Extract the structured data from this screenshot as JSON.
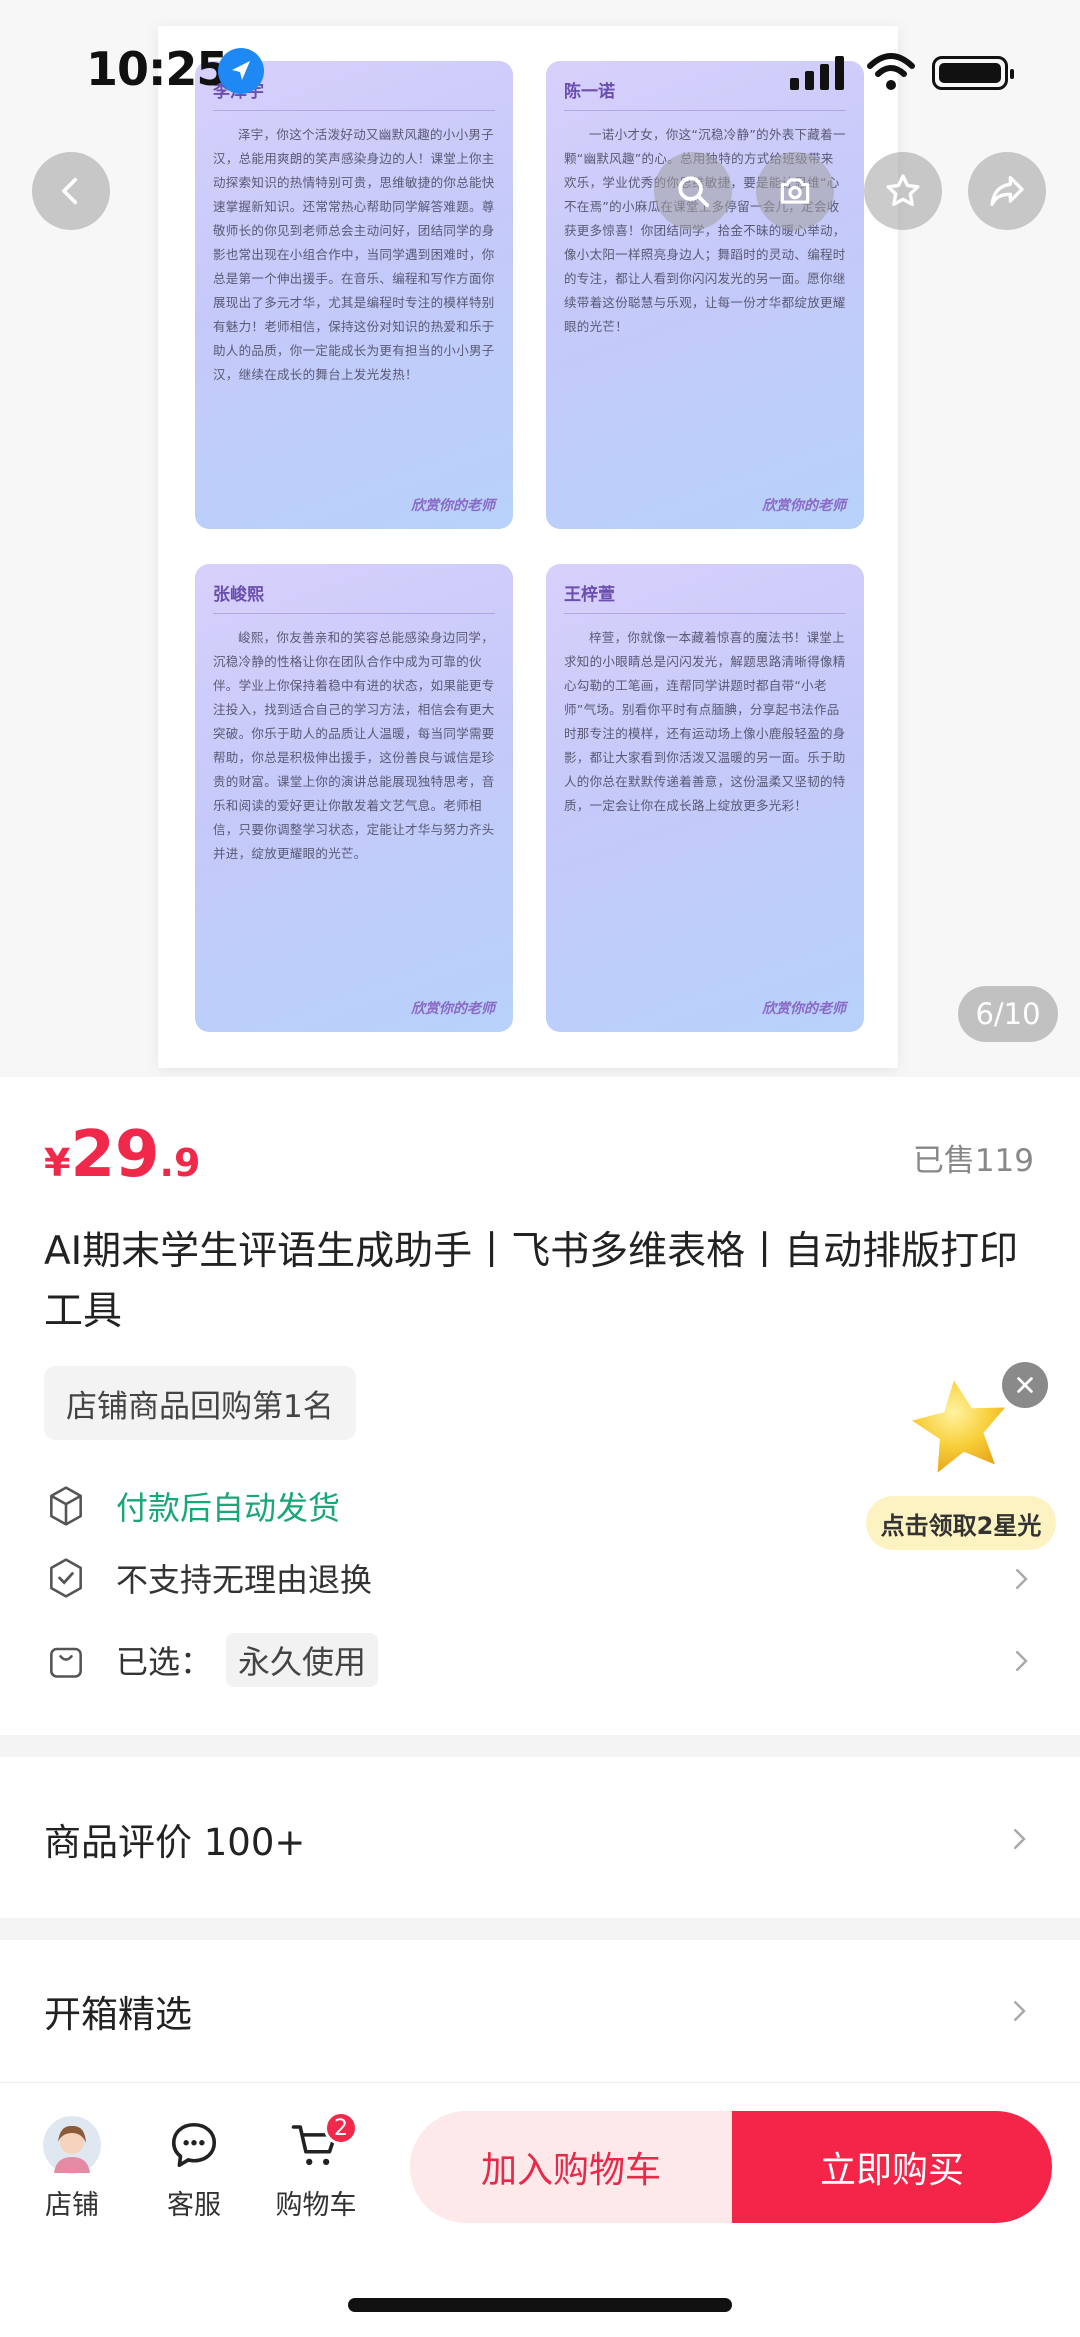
{
  "status_bar": {
    "time": "10:25"
  },
  "gallery": {
    "counter": "6/10",
    "cards": [
      {
        "name": "李泽宇",
        "body": "泽宇，你这个活泼好动又幽默风趣的小小男子汉，总能用爽朗的笑声感染身边的人！课堂上你主动探索知识的热情特别可贵，思维敏捷的你总能快速掌握新知识。还常常热心帮助同学解答难题。尊敬师长的你见到老师总会主动问好，团结同学的身影也常出现在小组合作中，当同学遇到困难时，你总是第一个伸出援手。在音乐、编程和写作方面你展现出了多元才华，尤其是编程时专注的模样特别有魅力！老师相信，保持这份对知识的热爱和乐于助人的品质，你一定能成长为更有担当的小小男子汉，继续在成长的舞台上发光发热！",
        "sign": "欣赏你的老师"
      },
      {
        "name": "陈一诺",
        "body": "一诺小才女，你这“沉稳冷静”的外表下藏着一颗“幽默风趣”的心。总用独特的方式给班级带来欢乐，学业优秀的你思维敏捷，要是能让思维“心不在焉”的小麻瓜在课堂上多停留一会儿，定会收获更多惊喜！你团结同学，拾金不昧的暖心举动，像小太阳一样照亮身边人；舞蹈时的灵动、编程时的专注，都让人看到你闪闪发光的另一面。愿你继续带着这份聪慧与乐观，让每一份才华都绽放更耀眼的光芒！",
        "sign": "欣赏你的老师"
      },
      {
        "name": "张峻熙",
        "body": "峻熙，你友善亲和的笑容总能感染身边同学，沉稳冷静的性格让你在团队合作中成为可靠的伙伴。学业上你保持着稳中有进的状态，如果能更专注投入，找到适合自己的学习方法，相信会有更大突破。你乐于助人的品质让人温暖，每当同学需要帮助，你总是积极伸出援手，这份善良与诚信是珍贵的财富。课堂上你的演讲总能展现独特思考，音乐和阅读的爱好更让你散发着文艺气息。老师相信，只要你调整学习状态，定能让才华与努力齐头并进，绽放更耀眼的光芒。",
        "sign": "欣赏你的老师"
      },
      {
        "name": "王梓萱",
        "body": "梓萱，你就像一本藏着惊喜的魔法书！课堂上求知的小眼睛总是闪闪发光，解题思路清晰得像精心勾勒的工笔画，连帮同学讲题时都自带“小老师”气场。别看你平时有点腼腆，分享起书法作品时那专注的模样，还有运动场上像小鹿般轻盈的身影，都让大家看到你活泼又温暖的另一面。乐于助人的你总在默默传递着善意，这份温柔又坚韧的特质，一定会让你在成长路上绽放更多光彩！",
        "sign": "欣赏你的老师"
      }
    ]
  },
  "product": {
    "price_symbol": "¥",
    "price_int": "29",
    "price_dec": ".9",
    "sold": "已售119",
    "title": "AI期末学生评语生成助手丨飞书多维表格丨自动排版打印工具",
    "rank_tag": "店铺商品回购第1名",
    "delivery": "付款后自动发货",
    "return_policy": "不支持无理由退换",
    "selected_label": "已选：",
    "selected_value": "永久使用",
    "promo": "点击领取2星光"
  },
  "sections": {
    "reviews": "商品评价 100+",
    "unboxing": "开箱精选"
  },
  "bottom_bar": {
    "shop": "店铺",
    "service": "客服",
    "cart": "购物车",
    "cart_count": "2",
    "add_to_cart": "加入购物车",
    "buy_now": "立即购买"
  },
  "colors": {
    "accent": "#f0284a",
    "green": "#1aa679",
    "card_from": "#d8d0fb",
    "card_to": "#b7d2fb"
  }
}
